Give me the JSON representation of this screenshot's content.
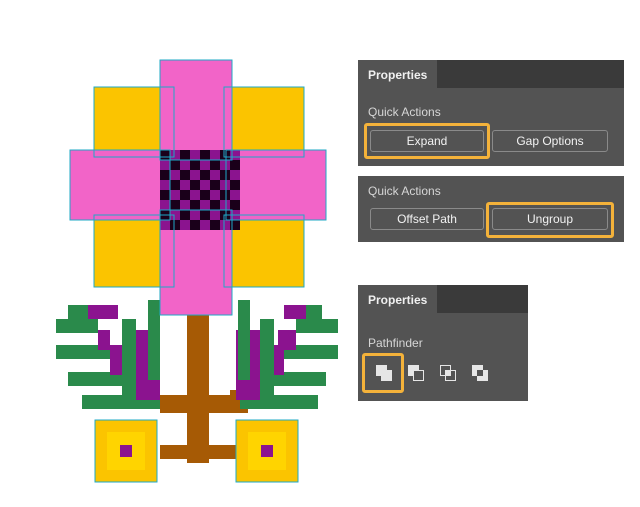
{
  "panel_top": {
    "tab": "Properties",
    "section": "Quick Actions",
    "buttons": [
      "Expand",
      "Gap Options"
    ],
    "highlighted": "Expand"
  },
  "panel_mid": {
    "section": "Quick Actions",
    "buttons": [
      "Offset Path",
      "Ungroup"
    ],
    "highlighted": "Ungroup"
  },
  "panel_bottom": {
    "tab": "Properties",
    "section": "Pathfinder",
    "icons": [
      "pathfinder-unite-icon",
      "pathfinder-minus-front-icon",
      "pathfinder-intersect-icon",
      "pathfinder-exclude-icon"
    ],
    "highlighted": "pathfinder-unite-icon"
  },
  "colors": {
    "panel": "#535353",
    "highlight": "#f4b23a",
    "pink": "#f264c8",
    "yellow": "#fbc400",
    "purple": "#8b138f",
    "green": "#2a8a4b",
    "brown": "#a65a05",
    "anchor": "#1ea9c6"
  }
}
